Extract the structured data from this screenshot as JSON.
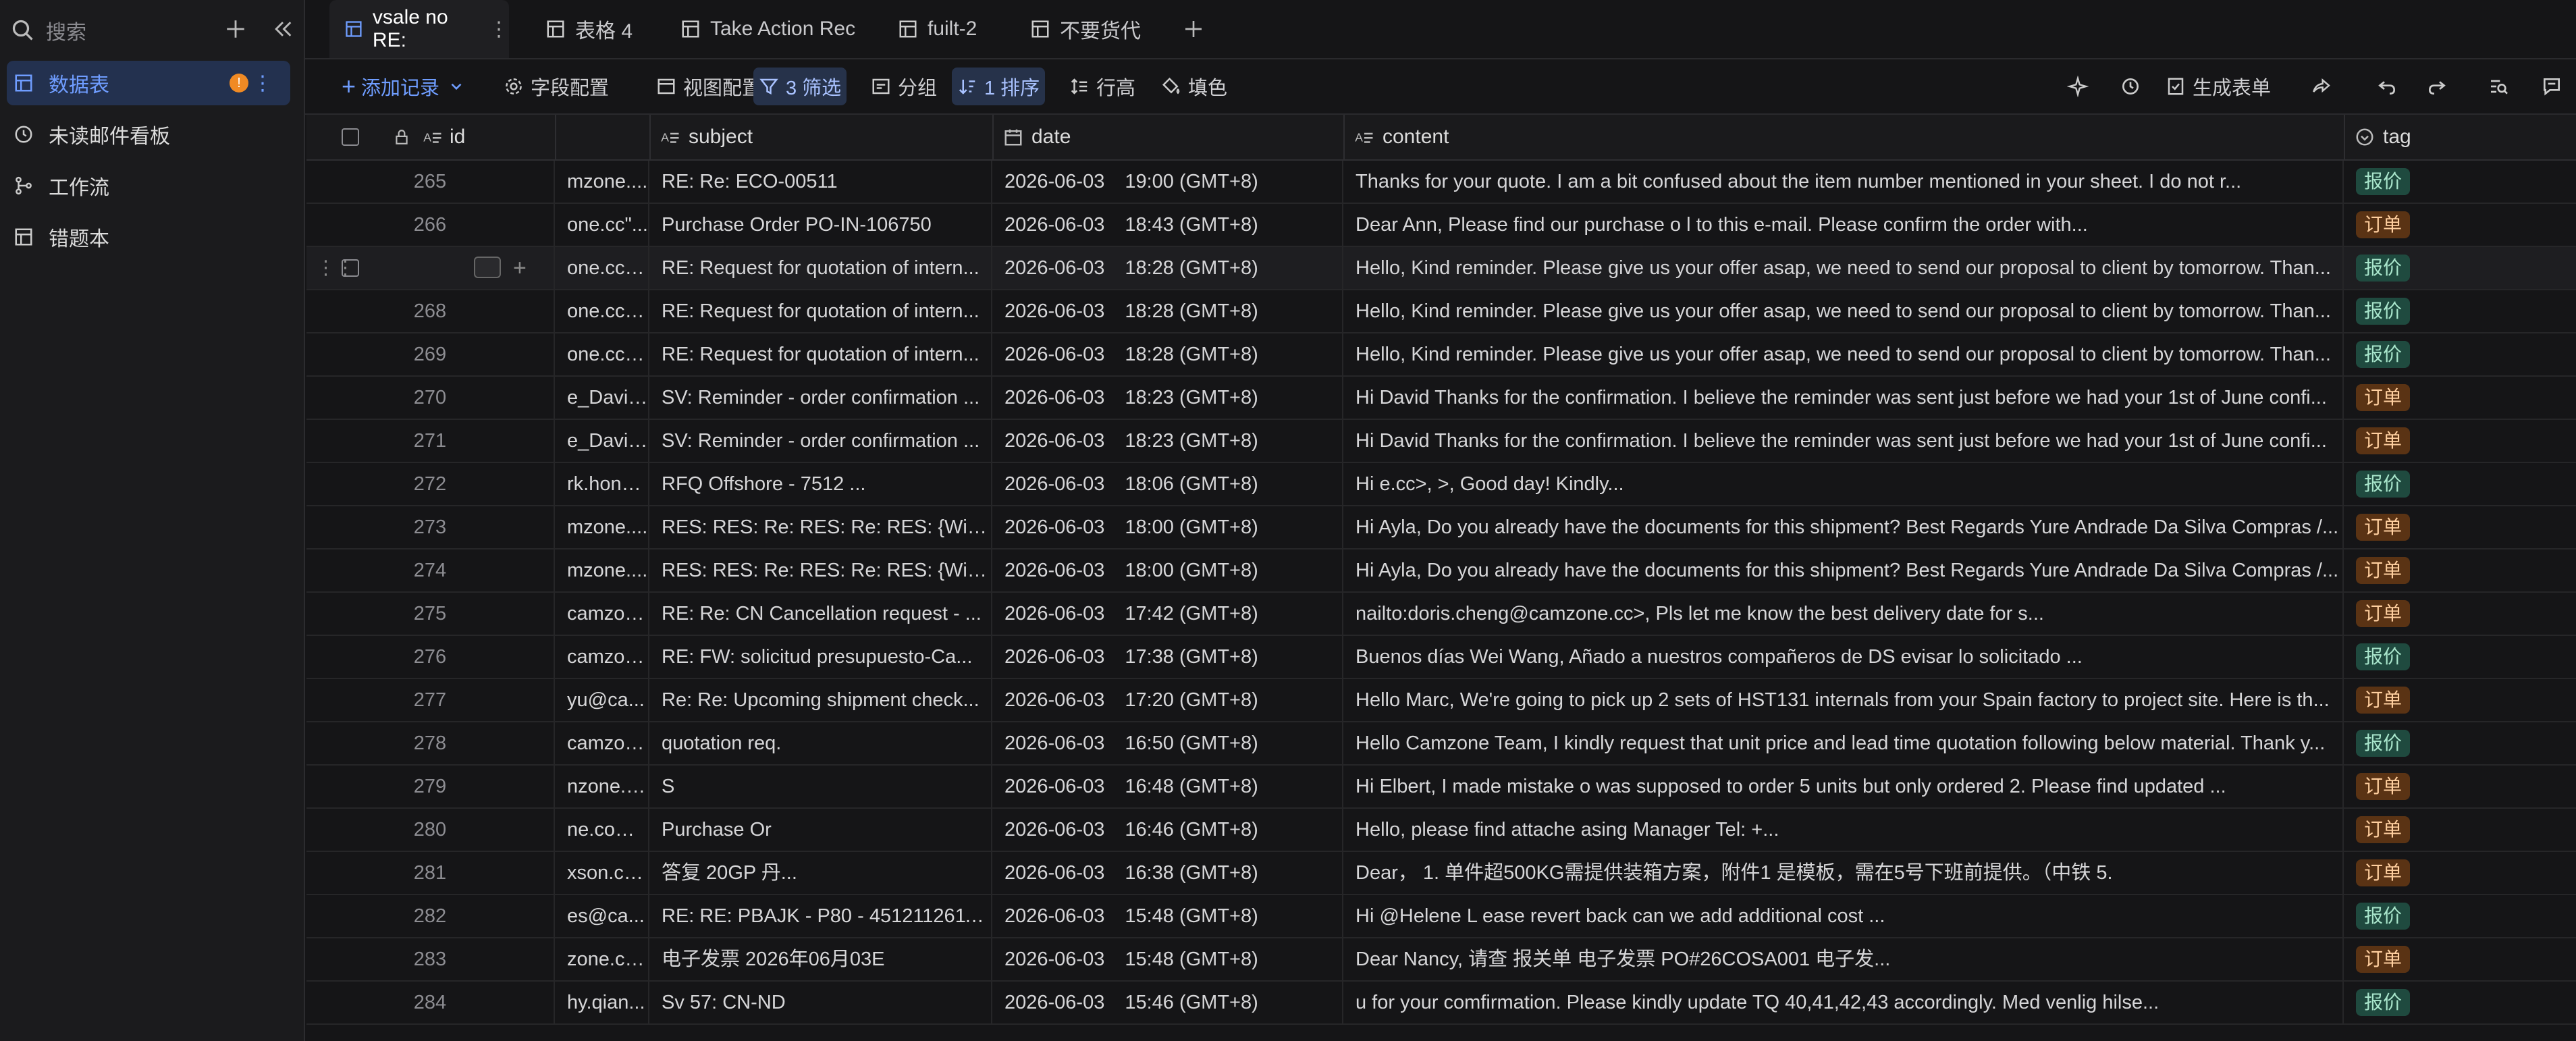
{
  "sidebar": {
    "search": "搜索",
    "items": [
      {
        "label": "数据表",
        "badge": "!"
      },
      {
        "label": "未读邮件看板"
      },
      {
        "label": "工作流"
      },
      {
        "label": "错题本"
      }
    ]
  },
  "tabs": [
    {
      "label": "vsale no RE:"
    },
    {
      "label": "表格 4"
    },
    {
      "label": "Take Action Rec"
    },
    {
      "label": "fuilt-2"
    },
    {
      "label": "不要货代"
    }
  ],
  "toolbar": {
    "add_record": "添加记录",
    "field_config": "字段配置",
    "view_config": "视图配置",
    "filter": "3 筛选",
    "group": "分组",
    "sort": "1 排序",
    "row_height": "行高",
    "fill": "填色",
    "generate_form": "生成表单"
  },
  "columns": {
    "id": "id",
    "subject": "subject",
    "date": "date",
    "content": "content",
    "tag": "tag"
  },
  "colors": {
    "accent": "#6f9dff",
    "tag_quote_bg": "#1f4a3f",
    "tag_order_bg": "#5a3314"
  },
  "rows": [
    {
      "n": "265",
      "from": "mzone....",
      "subject": "RE: Re: ECO-00511",
      "date": "2026-06-03",
      "time": "19:00 (GMT+8)",
      "content": "Thanks for your quote. I am a bit confused about the item number mentioned in your sheet. I do not r...",
      "tag": "报价"
    },
    {
      "n": "266",
      "from": "one.cc\"...",
      "subject": "Purchase Order PO-IN-106750",
      "date": "2026-06-03",
      "time": "18:43 (GMT+8)",
      "content": "Dear Ann, Please find our purchase o                    l to this e-mail. Please confirm the order with...",
      "tag": "订单"
    },
    {
      "n": "",
      "from": "one.cc\" ...",
      "subject": "RE: Request for quotation of intern...",
      "date": "2026-06-03",
      "time": "18:28 (GMT+8)",
      "content": "Hello, Kind reminder. Please give us your offer asap, we need to send our proposal to client by tomorrow. Than...",
      "tag": "报价"
    },
    {
      "n": "268",
      "from": "one.cc\" ...",
      "subject": "RE: Request for quotation of intern...",
      "date": "2026-06-03",
      "time": "18:28 (GMT+8)",
      "content": "Hello, Kind reminder. Please give us your offer asap, we need to send our proposal to client by tomorrow. Than...",
      "tag": "报价"
    },
    {
      "n": "269",
      "from": "one.cc\" ...",
      "subject": "RE: Request for quotation of intern...",
      "date": "2026-06-03",
      "time": "18:28 (GMT+8)",
      "content": "Hello, Kind reminder. Please give us your offer asap, we need to send our proposal to client by tomorrow. Than...",
      "tag": "报价"
    },
    {
      "n": "270",
      "from": "e_David...",
      "subject": "SV: Reminder - order confirmation ...",
      "date": "2026-06-03",
      "time": "18:23 (GMT+8)",
      "content": "Hi David Thanks for the confirmation. I believe the reminder was sent just before we had your 1st of June confi...",
      "tag": "订单"
    },
    {
      "n": "271",
      "from": "e_David...",
      "subject": "SV: Reminder - order confirmation ...",
      "date": "2026-06-03",
      "time": "18:23 (GMT+8)",
      "content": "Hi David Thanks for the confirmation. I believe the reminder was sent just before we had your 1st of June confi...",
      "tag": "订单"
    },
    {
      "n": "272",
      "from": "rk.hong...",
      "subject": "RFQ              Offshore - 7512 ...",
      "date": "2026-06-03",
      "time": "18:06 (GMT+8)",
      "content": "Hi                                 e.cc>,                               >, Good day! Kindly...",
      "tag": "报价"
    },
    {
      "n": "273",
      "from": "mzone....",
      "subject": "RES: RES: Re: RES: Re: RES: {Wind...",
      "date": "2026-06-03",
      "time": "18:00 (GMT+8)",
      "content": "Hi Ayla, Do you already have the documents for this shipment? Best Regards Yure Andrade Da Silva Compras /...",
      "tag": "订单"
    },
    {
      "n": "274",
      "from": "mzone....",
      "subject": "RES: RES: Re: RES: Re: RES: {Wind...",
      "date": "2026-06-03",
      "time": "18:00 (GMT+8)",
      "content": "Hi Ayla, Do you already have the documents for this shipment? Best Regards Yure Andrade Da Silva Compras /...",
      "tag": "订单"
    },
    {
      "n": "275",
      "from": "camzon...",
      "subject": "RE: Re: CN Cancellation request - ...",
      "date": "2026-06-03",
      "time": "17:42 (GMT+8)",
      "content": "                            nailto:doris.cheng@camzone.cc>, Pls let me know the best delivery date for s...",
      "tag": "订单"
    },
    {
      "n": "276",
      "from": "camzon...",
      "subject": "RE: FW: solicitud presupuesto-Ca...",
      "date": "2026-06-03",
      "time": "17:38 (GMT+8)",
      "content": "Buenos días Wei Wang, Añado a nuestros compañeros de DS                          evisar lo solicitado ...",
      "tag": "报价"
    },
    {
      "n": "277",
      "from": "yu@ca...",
      "subject": "Re: Re: Upcoming shipment check...",
      "date": "2026-06-03",
      "time": "17:20 (GMT+8)",
      "content": "Hello Marc, We're going to pick up 2 sets of HST131 internals from your Spain factory to project site. Here is th...",
      "tag": "订单"
    },
    {
      "n": "278",
      "from": "camzon...",
      "subject": "quotation req.",
      "date": "2026-06-03",
      "time": "16:50 (GMT+8)",
      "content": "Hello Camzone Team, I kindly request that unit price and lead time quotation following below material. Thank y...",
      "tag": "报价"
    },
    {
      "n": "279",
      "from": "nzone.c...",
      "subject": "S",
      "date": "2026-06-03",
      "time": "16:48 (GMT+8)",
      "content": "Hi Elbert, I made mistake o            was supposed to order 5 units but only ordered 2. Please find updated ...",
      "tag": "订单"
    },
    {
      "n": "280",
      "from": "ne.com\"...",
      "subject": "Purchase Or",
      "date": "2026-06-03",
      "time": "16:46 (GMT+8)",
      "content": "Hello, please find attache                                       asing Manager Tel: +...",
      "tag": "订单"
    },
    {
      "n": "281",
      "from": "xson.co...",
      "subject": "答复             20GP 丹...",
      "date": "2026-06-03",
      "time": "16:38 (GMT+8)",
      "content": "Dear， 1. 单件超500KG需提供装箱方案，附件1 是模板，需在5号下班前提供。（中铁                     5.",
      "tag": "订单"
    },
    {
      "n": "282",
      "from": "es@ca...",
      "subject": "RE: RE: PBAJK - P80 - 4512112611 ...",
      "date": "2026-06-03",
      "time": "15:48 (GMT+8)",
      "content": "Hi @Helene L                                            ease revert back can we add additional cost ...",
      "tag": "报价"
    },
    {
      "n": "283",
      "from": "zone.cc\"...",
      "subject": "电子发票 2026年06月03E",
      "date": "2026-06-03",
      "time": "15:48 (GMT+8)",
      "content": "Dear Nancy, 请查                            报关单                  电子发票 PO#26COSA001 电子发...",
      "tag": "订单"
    },
    {
      "n": "284",
      "from": "hy.qian...",
      "subject": "Sv 57: CN-ND",
      "date": "2026-06-03",
      "time": "15:46 (GMT+8)",
      "content": "             u for your comfirmation. Please kindly update TQ 40,41,42,43 accordingly. Med venlig hilse...",
      "tag": "报价"
    }
  ]
}
